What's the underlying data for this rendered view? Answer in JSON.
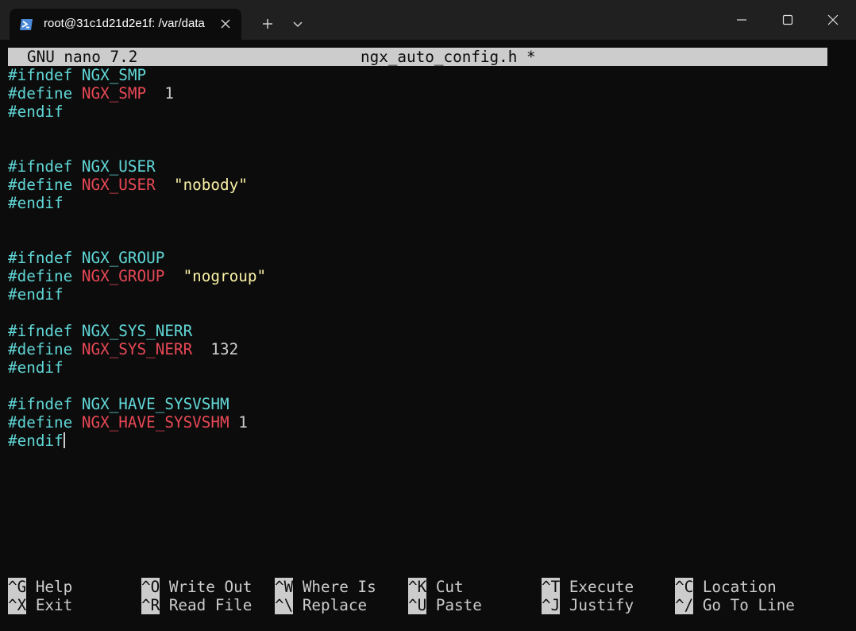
{
  "window": {
    "tab_title": "root@31c1d21d2e1f: /var/data"
  },
  "nano": {
    "app_name": "GNU nano 7.2",
    "file_title": "ngx_auto_config.h *"
  },
  "lines": [
    {
      "kw": "#ifndef",
      "name": "NGX_SMP",
      "val": ""
    },
    {
      "kw": "#define",
      "name": "NGX_SMP",
      "val": "1"
    },
    {
      "kw": "#endif",
      "name": "",
      "val": ""
    },
    {
      "kw": "",
      "name": "",
      "val": ""
    },
    {
      "kw": "",
      "name": "",
      "val": ""
    },
    {
      "kw": "#ifndef",
      "name": "NGX_USER",
      "val": ""
    },
    {
      "kw": "#define",
      "name": "NGX_USER",
      "val": "\"nobody\""
    },
    {
      "kw": "#endif",
      "name": "",
      "val": ""
    },
    {
      "kw": "",
      "name": "",
      "val": ""
    },
    {
      "kw": "",
      "name": "",
      "val": ""
    },
    {
      "kw": "#ifndef",
      "name": "NGX_GROUP",
      "val": ""
    },
    {
      "kw": "#define",
      "name": "NGX_GROUP",
      "val": "\"nogroup\""
    },
    {
      "kw": "#endif",
      "name": "",
      "val": ""
    },
    {
      "kw": "",
      "name": "",
      "val": ""
    },
    {
      "kw": "#ifndef",
      "name": "NGX_SYS_NERR",
      "val": ""
    },
    {
      "kw": "#define",
      "name": "NGX_SYS_NERR",
      "val": "132"
    },
    {
      "kw": "#endif",
      "name": "",
      "val": ""
    },
    {
      "kw": "",
      "name": "",
      "val": ""
    },
    {
      "kw": "#ifndef",
      "name": "NGX_HAVE_SYSVSHM",
      "val": ""
    },
    {
      "kw": "#define",
      "name": "NGX_HAVE_SYSVSHM",
      "val": "1"
    },
    {
      "kw": "#endif",
      "name": "",
      "val": ""
    }
  ],
  "shortcuts": [
    {
      "key": "^G",
      "label": "Help"
    },
    {
      "key": "^X",
      "label": "Exit"
    },
    {
      "key": "^O",
      "label": "Write Out"
    },
    {
      "key": "^R",
      "label": "Read File"
    },
    {
      "key": "^W",
      "label": "Where Is"
    },
    {
      "key": "^\\",
      "label": "Replace"
    },
    {
      "key": "^K",
      "label": "Cut"
    },
    {
      "key": "^U",
      "label": "Paste"
    },
    {
      "key": "^T",
      "label": "Execute"
    },
    {
      "key": "^J",
      "label": "Justify"
    },
    {
      "key": "^C",
      "label": "Location"
    },
    {
      "key": "^/",
      "label": "Go To Line"
    }
  ],
  "colors": {
    "keyword": "#61d6d6",
    "macro_name": "#e74856",
    "string": "#f9f1a5",
    "text": "#cccccc",
    "background": "#0c0c0c"
  },
  "icons": {
    "tab": "powershell-icon",
    "tab_close": "close-icon",
    "new_tab": "plus-icon",
    "dropdown": "chevron-down-icon",
    "minimize": "minimize-icon",
    "maximize": "maximize-icon",
    "close": "close-icon"
  }
}
